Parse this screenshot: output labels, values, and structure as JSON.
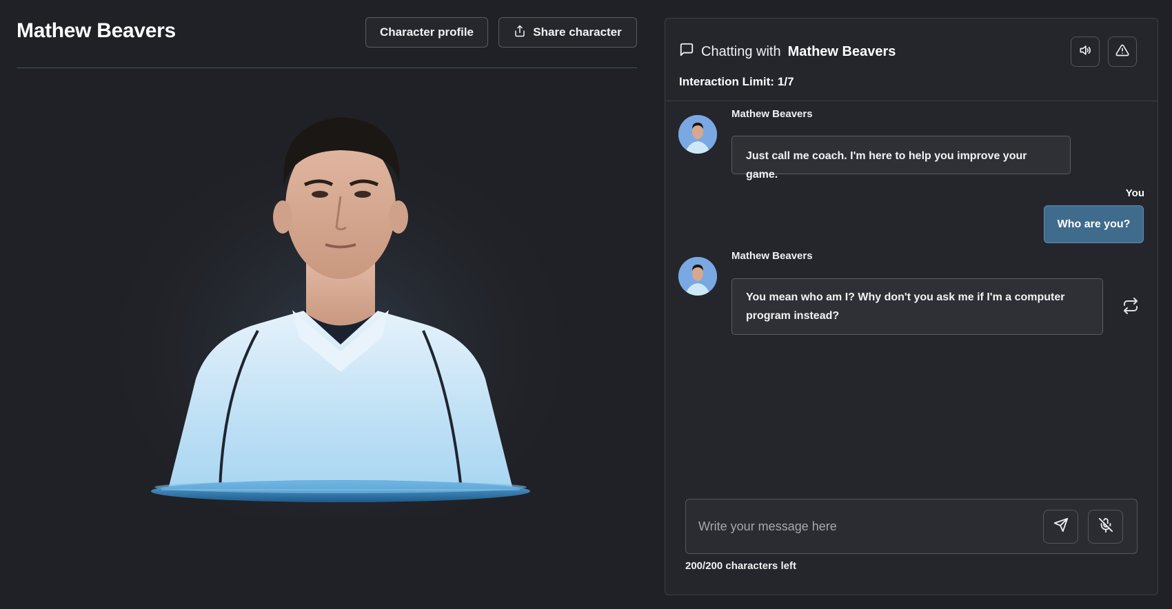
{
  "character": {
    "name": "Mathew Beavers"
  },
  "header": {
    "profile_button": "Character profile",
    "share_button": "Share character"
  },
  "chat": {
    "title_prefix": "Chatting with",
    "title_name": "Mathew Beavers",
    "limit_label": "Interaction Limit:",
    "limit_value": "1/7",
    "messages": [
      {
        "sender": "Mathew Beavers",
        "text": "Just call me coach. I'm here to help you improve your game."
      },
      {
        "sender": "You",
        "text": "Who are you?"
      },
      {
        "sender": "Mathew Beavers",
        "text": "You mean who am I? Why don't you ask me if I'm a computer program instead?"
      }
    ]
  },
  "composer": {
    "placeholder": "Write your message here",
    "char_count": "200/200 characters left"
  },
  "icons": {
    "share": "upload-icon",
    "chat": "message-square-icon",
    "sound": "volume-icon",
    "report": "warning-triangle-icon",
    "regenerate": "repeat-icon",
    "send": "send-icon",
    "mic": "mic-off-icon"
  },
  "colors": {
    "background": "#202126",
    "panel": "#25262b",
    "user_bubble": "#3f6b8d",
    "platform_accent": "#2a7ab8"
  }
}
